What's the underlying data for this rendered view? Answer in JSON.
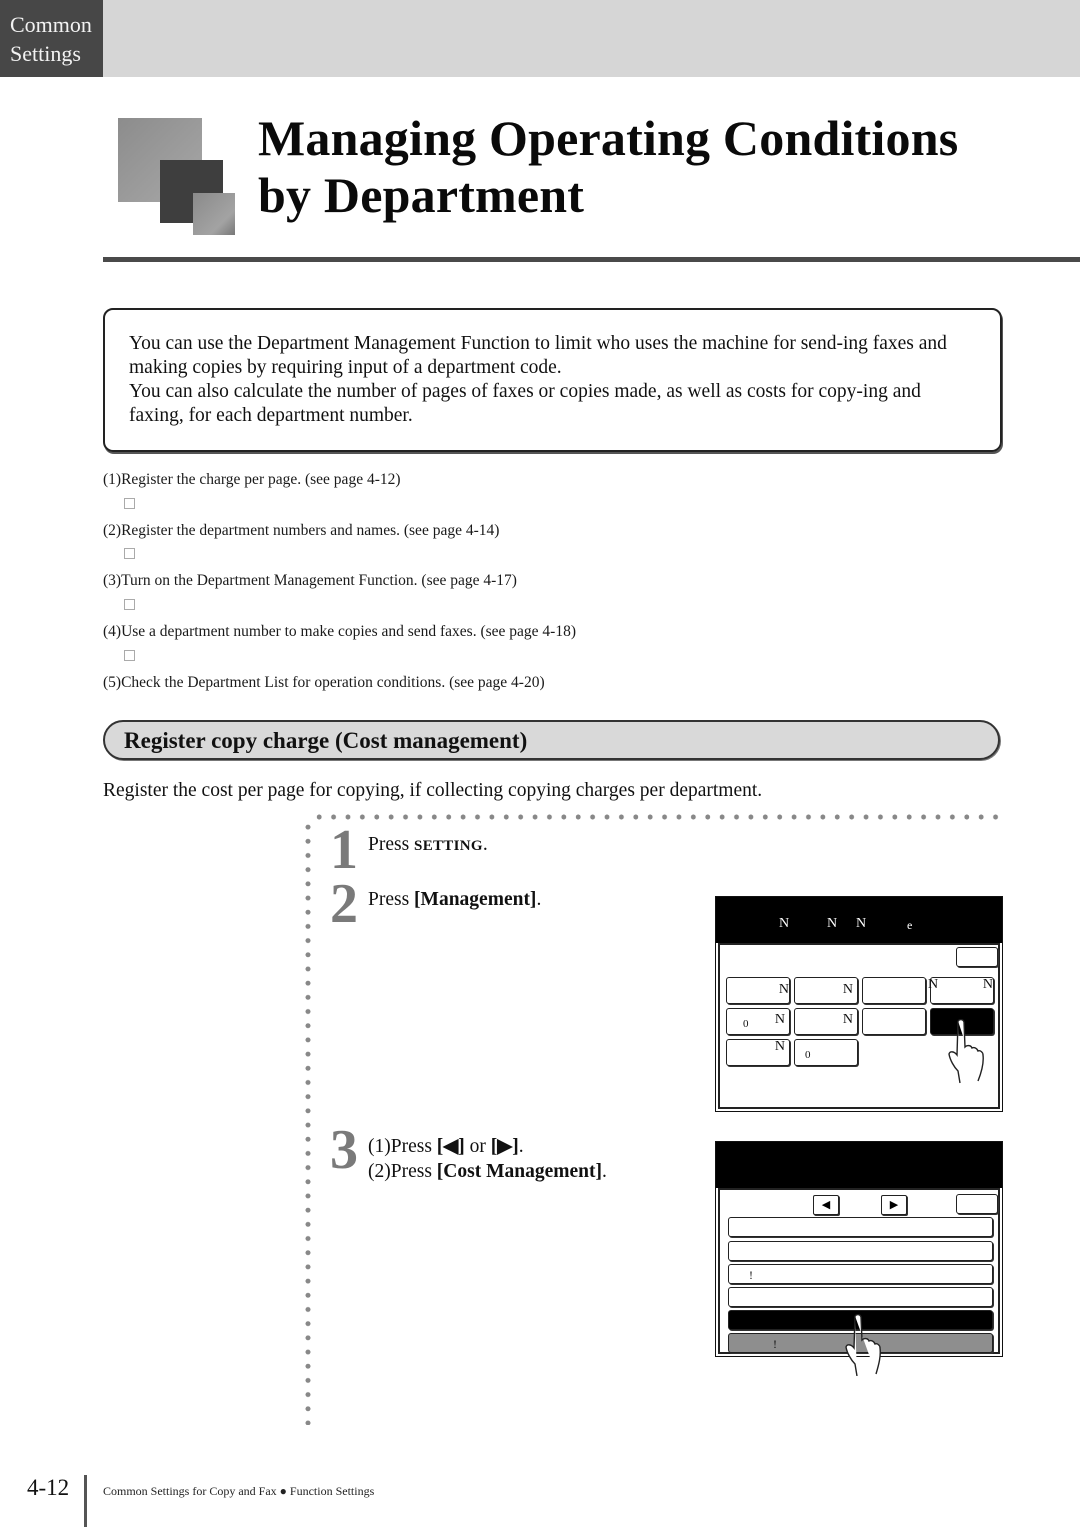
{
  "header": {
    "section_tab_line1": "Common",
    "section_tab_line2": "Settings"
  },
  "title": {
    "line1": "Managing Operating Conditions",
    "line2": "by Department"
  },
  "intro": {
    "paragraph1": "You can use the Department Management Function to limit who uses the machine for send-ing faxes and making copies by requiring input of a department code.",
    "paragraph2": "You can also calculate the number of pages of faxes or copies made, as well as costs for copy-ing and faxing, for each department number."
  },
  "overview_steps": [
    "(1)Register the charge per page. (see page 4-12)",
    "(2)Register the department numbers and names. (see page 4-14)",
    "(3)Turn on the Department Management Function. (see page 4-17)",
    "(4)Use a department number to make copies and send faxes. (see page 4-18)",
    "(5)Check the Department List for operation conditions. (see page 4-20)"
  ],
  "section": {
    "heading": "Register copy charge (Cost management)",
    "description": "Register the cost per page for copying, if collecting copying charges per department."
  },
  "steps": [
    {
      "number": "1",
      "prefix": "Press ",
      "key": "SETTING",
      "suffix": "."
    },
    {
      "number": "2",
      "prefix": "Press ",
      "key": "[Management]",
      "suffix": "."
    },
    {
      "number": "3",
      "sub1_prefix": "(1)Press ",
      "sub1_left": "[◀]",
      "sub1_mid": " or ",
      "sub1_right": "[▶]",
      "sub1_suffix": ".",
      "sub2_prefix": "(2)Press ",
      "sub2_key": "[Cost Management]",
      "sub2_suffix": "."
    }
  ],
  "screen1": {
    "bar_glyphs": [
      "N",
      "N",
      "N",
      "e"
    ],
    "button_glyphs": {
      "r1c1": "N",
      "r1c2": "N",
      "r1c4a": "N",
      "r1c4b": "N",
      "r2c1a": "0",
      "r2c1b": "N",
      "r2c2": "N",
      "r3c1": "N",
      "r3c2": "0"
    }
  },
  "screen2": {
    "left_arrow": "◀",
    "right_arrow": "▶",
    "row3_glyph": "!",
    "row6_glyph": "!"
  },
  "footer": {
    "page_number": "4-12",
    "text_left": "Common Settings for Copy and Fax",
    "bullet": "●",
    "text_right": "Function Settings"
  }
}
